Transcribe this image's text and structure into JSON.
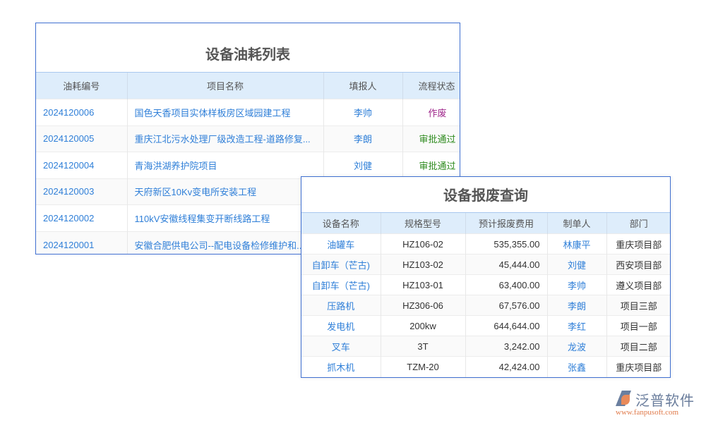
{
  "fuel_list": {
    "title": "设备油耗列表",
    "headers": [
      "油耗编号",
      "项目名称",
      "填报人",
      "流程状态"
    ],
    "rows": [
      {
        "id": "2024120006",
        "project": "国色天香项目实体样板房区域园建工程",
        "reporter": "李帅",
        "status": "作废",
        "status_type": "void"
      },
      {
        "id": "2024120005",
        "project": "重庆江北污水处理厂级改造工程-道路修复...",
        "reporter": "李朗",
        "status": "审批通过",
        "status_type": "ok"
      },
      {
        "id": "2024120004",
        "project": "青海洪湖养护院项目",
        "reporter": "刘健",
        "status": "审批通过",
        "status_type": "ok"
      },
      {
        "id": "2024120003",
        "project": "天府新区10Kv变电所安装工程",
        "reporter": "",
        "status": "",
        "status_type": ""
      },
      {
        "id": "2024120002",
        "project": "110kV安徽线程集变开断线路工程",
        "reporter": "",
        "status": "",
        "status_type": ""
      },
      {
        "id": "2024120001",
        "project": "安徽合肥供电公司--配电设备检修维护和...",
        "reporter": "",
        "status": "",
        "status_type": ""
      }
    ]
  },
  "scrap_query": {
    "title": "设备报废查询",
    "headers": [
      "设备名称",
      "规格型号",
      "预计报废费用",
      "制单人",
      "部门"
    ],
    "rows": [
      {
        "name": "油罐车",
        "model": "HZ106-02",
        "cost": "535,355.00",
        "maker": "林康平",
        "dept": "重庆项目部"
      },
      {
        "name": "自卸车（芒古)",
        "model": "HZ103-02",
        "cost": "45,444.00",
        "maker": "刘健",
        "dept": "西安项目部"
      },
      {
        "name": "自卸车（芒古)",
        "model": "HZ103-01",
        "cost": "63,400.00",
        "maker": "李帅",
        "dept": "遵义项目部"
      },
      {
        "name": "压路机",
        "model": "HZ306-06",
        "cost": "67,576.00",
        "maker": "李朗",
        "dept": "项目三部"
      },
      {
        "name": "发电机",
        "model": "200kw",
        "cost": "644,644.00",
        "maker": "李红",
        "dept": "项目一部"
      },
      {
        "name": "叉车",
        "model": "3T",
        "cost": "3,242.00",
        "maker": "龙波",
        "dept": "项目二部"
      },
      {
        "name": "抓木机",
        "model": "TZM-20",
        "cost": "42,424.00",
        "maker": "张鑫",
        "dept": "重庆项目部"
      }
    ]
  },
  "logo": {
    "name": "泛普软件",
    "url": "www.fanpusoft.com"
  },
  "colors": {
    "link": "#2f7fd8",
    "void": "#a0288c",
    "approved": "#2e8b1e",
    "header_bg": "#deedfb",
    "border": "#3f6fd0"
  }
}
